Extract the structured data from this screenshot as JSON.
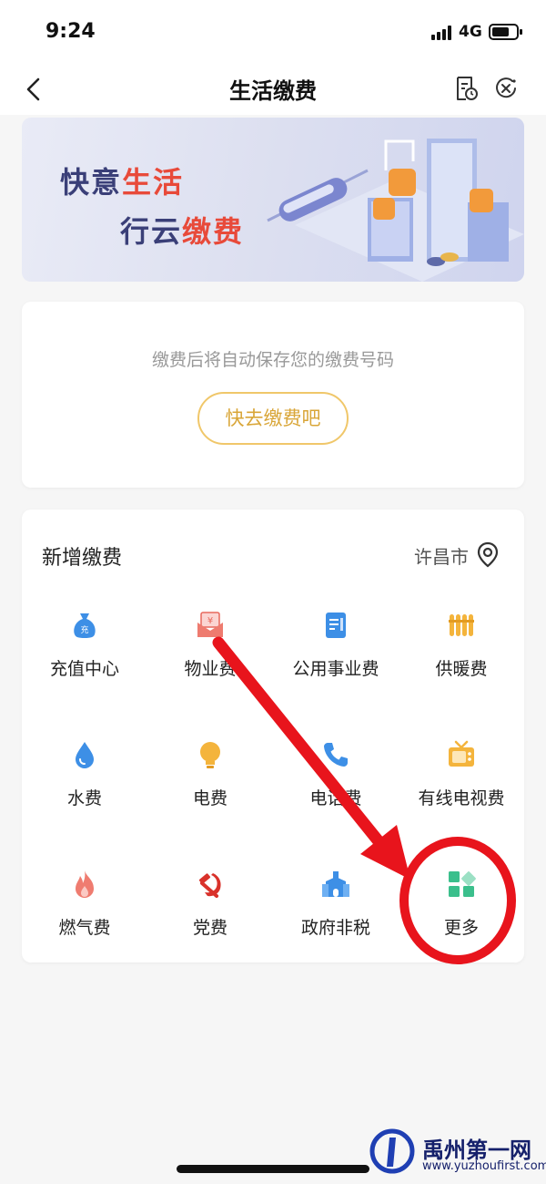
{
  "status": {
    "time": "9:24",
    "network": "4G"
  },
  "nav": {
    "title": "生活缴费"
  },
  "banner": {
    "line1_a": "快意",
    "line1_b": "生活",
    "line2_a": "行云",
    "line2_b": "缴费"
  },
  "saved": {
    "hint": "缴费后将自动保存您的缴费号码",
    "button": "快去缴费吧"
  },
  "add": {
    "title": "新增缴费",
    "city": "许昌市",
    "items": [
      {
        "label": "充值中心",
        "icon": "money-bag-icon"
      },
      {
        "label": "物业费",
        "icon": "property-icon"
      },
      {
        "label": "公用事业费",
        "icon": "document-icon"
      },
      {
        "label": "供暖费",
        "icon": "radiator-icon"
      },
      {
        "label": "水费",
        "icon": "water-drop-icon"
      },
      {
        "label": "电费",
        "icon": "bulb-icon"
      },
      {
        "label": "电话费",
        "icon": "phone-icon"
      },
      {
        "label": "有线电视费",
        "icon": "tv-icon"
      },
      {
        "label": "燃气费",
        "icon": "flame-icon"
      },
      {
        "label": "党费",
        "icon": "party-emblem-icon"
      },
      {
        "label": "政府非税",
        "icon": "government-icon"
      },
      {
        "label": "更多",
        "icon": "more-grid-icon"
      }
    ]
  },
  "watermark": {
    "title": "禹州第一网",
    "url": "www.yuzhoufirst.com"
  },
  "colors": {
    "accent_gold": "#d9a638",
    "banner_red": "#e84a3a",
    "annotation_red": "#e8141c"
  }
}
